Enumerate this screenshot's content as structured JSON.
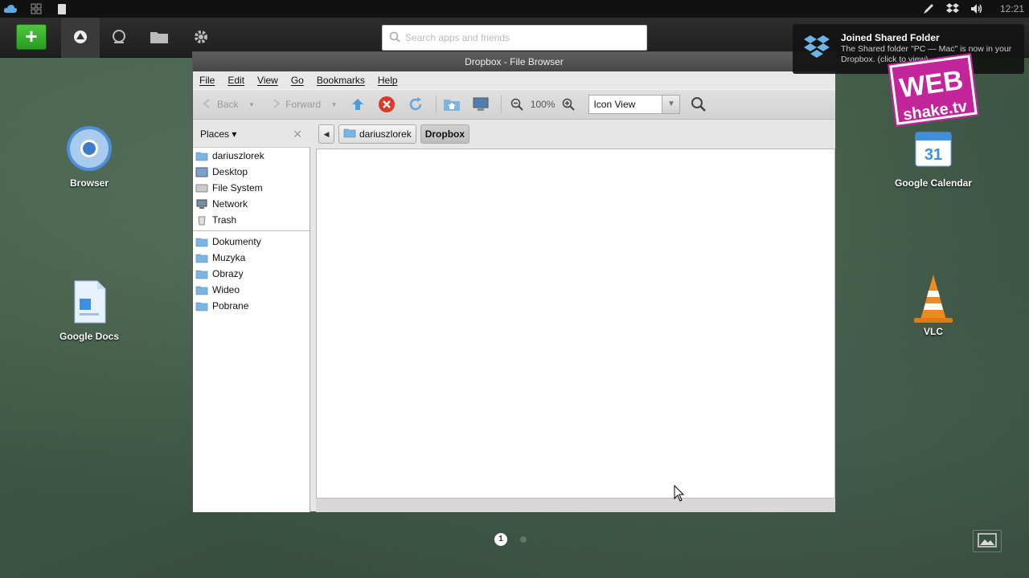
{
  "system_bar": {
    "clock": "12:21"
  },
  "launcher": {
    "add_label": "+",
    "search_placeholder": "Search apps and friends"
  },
  "desktop_icons": [
    {
      "label": "Browser"
    },
    {
      "label": "Google Docs"
    },
    {
      "label": "Google Calendar"
    },
    {
      "label": "VLC"
    }
  ],
  "window": {
    "title": "Dropbox - File Browser",
    "menu": [
      "File",
      "Edit",
      "View",
      "Go",
      "Bookmarks",
      "Help"
    ],
    "toolbar": {
      "back": "Back",
      "forward": "Forward",
      "zoom": "100%",
      "view_mode": "Icon View"
    },
    "places": {
      "header": "Places ▾",
      "items": [
        "dariuszlorek",
        "Desktop",
        "File System",
        "Network",
        "Trash"
      ],
      "bookmarks": [
        "Dokumenty",
        "Muzyka",
        "Obrazy",
        "Wideo",
        "Pobrane"
      ]
    },
    "path": [
      "dariuszlorek",
      "Dropbox"
    ]
  },
  "notification": {
    "title": "Joined Shared Folder",
    "body": "The Shared folder \"PC — Mac\" is now in your Dropbox. (click to view)"
  },
  "watermark": {
    "line1": "WEB",
    "line2": "shake.tv"
  },
  "pager": {
    "current": "1"
  },
  "colors": {
    "accent_green": "#3cb82e",
    "window_title_bg": "#4f4f4f"
  }
}
